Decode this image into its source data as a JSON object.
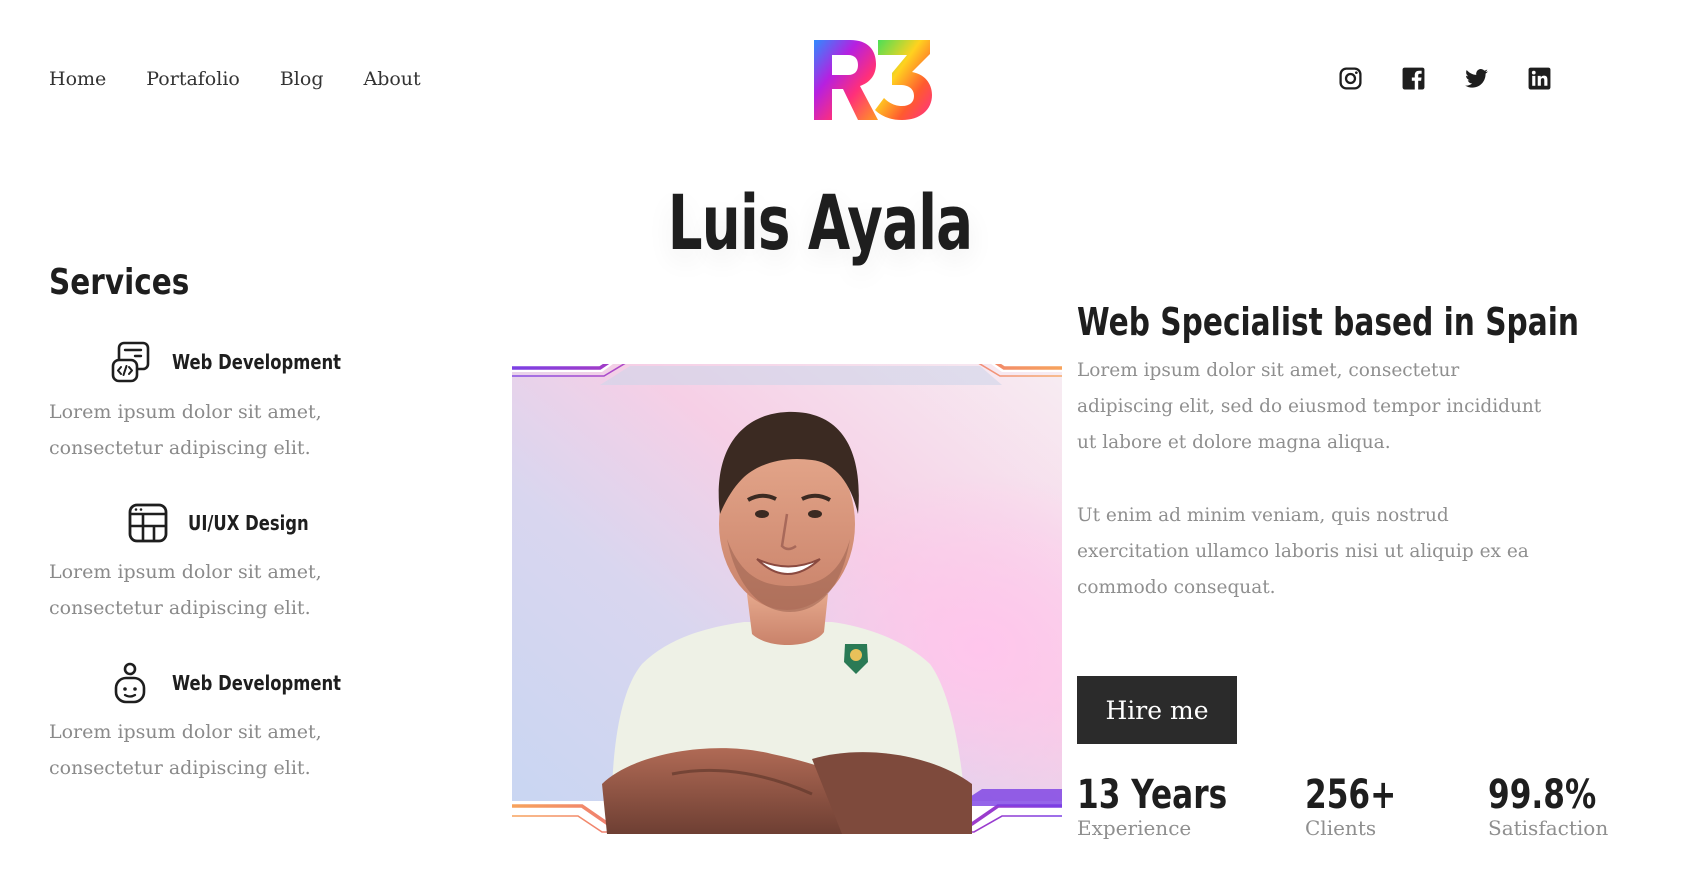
{
  "nav": {
    "items": [
      {
        "label": "Home"
      },
      {
        "label": "Portafolio"
      },
      {
        "label": "Blog"
      },
      {
        "label": "About"
      }
    ]
  },
  "logo": {
    "text": "R3"
  },
  "social": {
    "icons": [
      "instagram-icon",
      "facebook-icon",
      "twitter-icon",
      "linkedin-icon"
    ]
  },
  "hero": {
    "name": "Luis Ayala"
  },
  "services": {
    "title": "Services",
    "items": [
      {
        "name": "Web Development",
        "icon": "code-window-icon",
        "description": "Lorem ipsum dolor sit amet, consectetur adipiscing elit."
      },
      {
        "name": "UI/UX Design",
        "icon": "layout-icon",
        "description": "Lorem ipsum dolor sit amet, consectetur adipiscing elit."
      },
      {
        "name": "Web Development",
        "icon": "user-icon",
        "description": "Lorem ipsum dolor sit amet, consectetur adipiscing elit."
      }
    ]
  },
  "about": {
    "subtitle": "Web Specialist based in Spain",
    "paragraph1": "Lorem ipsum dolor sit amet, consectetur adipiscing elit, sed do eiusmod tempor incididunt ut labore et dolore magna aliqua.",
    "paragraph2": "Ut enim ad minim veniam, quis nostrud exercitation ullamco laboris nisi ut aliquip ex ea commodo consequat.",
    "hire_label": "Hire me"
  },
  "stats": [
    {
      "value": "13 Years",
      "label": "Experience"
    },
    {
      "value": "256+",
      "label": "Clients"
    },
    {
      "value": "99.8%",
      "label": "Satisfaction"
    }
  ],
  "colors": {
    "dark": "#2b2b2b",
    "muted_text": "#8f8f8f",
    "accent_purple": "#7b3fe4",
    "accent_pink": "#e0359a",
    "accent_orange": "#f7a35c"
  }
}
